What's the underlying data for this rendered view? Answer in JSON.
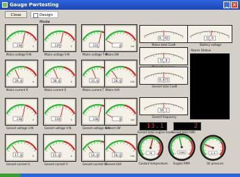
{
  "window": {
    "title": "Gauge Pwrtesting",
    "min_label": "_",
    "close_label": "×"
  },
  "toolbar": {
    "close_label": "Close",
    "design_mode_label": "Design Mode"
  },
  "gauges": [
    {
      "label": "Mains voltage R-N",
      "value": "230",
      "unit": "V",
      "level": 0.6
    },
    {
      "label": "Mains voltage S-N",
      "value": "229",
      "unit": "V",
      "level": 0.6
    },
    {
      "label": "Mains voltage T-N",
      "value": "231",
      "unit": "V",
      "level": 0.6
    },
    {
      "label": "Mains kW",
      "value": "0",
      "unit": "kW",
      "level": 0.0
    },
    {
      "label": "Mains current R",
      "value": "28,0",
      "unit": "A",
      "level": 0.3
    },
    {
      "label": "Mains current S",
      "value": "30,0",
      "unit": "A",
      "level": 0.32
    },
    {
      "label": "Mains current T",
      "value": "31,0",
      "unit": "A",
      "level": 0.33
    },
    {
      "label": "Mains kVA",
      "value": "20,0",
      "unit": "kVA",
      "level": 0.22
    },
    {
      "label": "Genset voltage U-N",
      "value": "230",
      "unit": "V",
      "level": 0.6
    },
    {
      "label": "Genset voltage V-N",
      "value": "229",
      "unit": "V",
      "level": 0.6
    },
    {
      "label": "Genset voltage W-N",
      "value": "230",
      "unit": "V",
      "level": 0.6
    },
    {
      "label": "Genset kW",
      "value": "0",
      "unit": "kW",
      "level": 0.0
    },
    {
      "label": "Genset current U",
      "value": "17,0",
      "unit": "A",
      "level": 0.2
    },
    {
      "label": "Genset current V",
      "value": "15,0",
      "unit": "A",
      "level": 0.18
    },
    {
      "label": "Genset current W",
      "value": "14,0",
      "unit": "A",
      "level": 0.17
    },
    {
      "label": "Genset kVA",
      "value": "10,0",
      "unit": "kVA",
      "level": 0.12
    }
  ],
  "arcs": [
    {
      "label": "Mains total CosΦ",
      "value": "0,143",
      "level": 0.5
    },
    {
      "label": "Battery voltage",
      "value": "12,0",
      "level": 0.55
    },
    {
      "label": "Mains frequency",
      "value": "51,0",
      "level": 0.5
    },
    {
      "label": "Genset total CosΦ",
      "value": "0,873",
      "level": 0.5
    },
    {
      "label": "Genset frequency",
      "value": "50,1",
      "level": 0.5
    }
  ],
  "alarm": {
    "label": "Alarm Status"
  },
  "digital": [
    {
      "label": "Genset total engine hours",
      "value": "13.1"
    },
    {
      "label": "Genset total kWh",
      "value": "2"
    }
  ],
  "round": [
    {
      "label": "Coolant temperature",
      "value": "70",
      "level": 0.55,
      "color": "#d92020"
    },
    {
      "label": "Engine RPM",
      "value": "1500",
      "level": 0.45,
      "color": "#18b22a"
    },
    {
      "label": "Oil pressure",
      "value": "4,0",
      "level": 0.25,
      "color": "#d92020"
    }
  ],
  "colors": {
    "green": "#1fbf2f",
    "red": "#e02020",
    "face": "#f4f1e6"
  }
}
